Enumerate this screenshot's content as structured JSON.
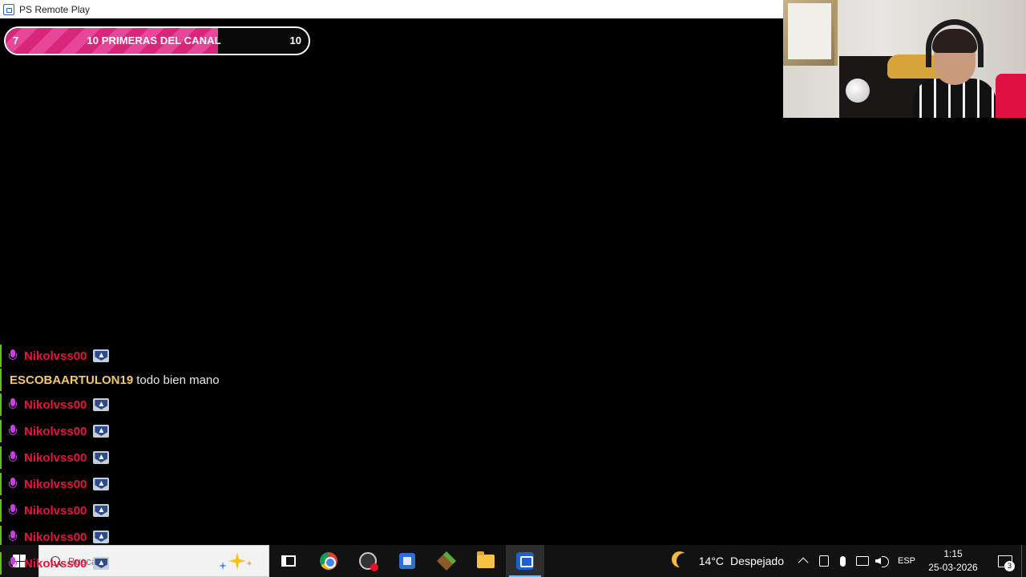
{
  "window": {
    "title": "PS Remote Play"
  },
  "goal": {
    "start": "7",
    "label": "10 PRIMERAS DEL CANAL",
    "end": "10",
    "progress_fraction": 0.7
  },
  "chat": {
    "messages": [
      {
        "user": "Nikolvss00",
        "text": "",
        "user_color": "#e8133f"
      },
      {
        "user": "ESCOBAARTULON19",
        "text": "todo bien mano",
        "user_color": "#f3c86a"
      },
      {
        "user": "Nikolvss00",
        "text": "",
        "user_color": "#e8133f"
      },
      {
        "user": "Nikolvss00",
        "text": "",
        "user_color": "#e8133f"
      },
      {
        "user": "Nikolvss00",
        "text": "",
        "user_color": "#e8133f"
      },
      {
        "user": "Nikolvss00",
        "text": "",
        "user_color": "#e8133f"
      },
      {
        "user": "Nikolvss00",
        "text": "",
        "user_color": "#e8133f"
      },
      {
        "user": "Nikolvss00",
        "text": "",
        "user_color": "#e8133f"
      },
      {
        "user": "Nikolvss00",
        "text": "",
        "user_color": "#e8133f"
      }
    ]
  },
  "taskbar": {
    "search_placeholder": "Buscar",
    "apps": [
      "task-view",
      "chrome",
      "obs",
      "store",
      "minecraft",
      "file-explorer",
      "ps-remote-play"
    ],
    "weather": {
      "temp": "14°C",
      "condition": "Despejado"
    },
    "language": "ESP",
    "time": "1:15",
    "date": "25-03-2026",
    "notification_count": "3"
  },
  "colors": {
    "accent_pink": "#d9267a",
    "chat_bar": "#5fbf1f",
    "mic": "#c83fe0"
  }
}
